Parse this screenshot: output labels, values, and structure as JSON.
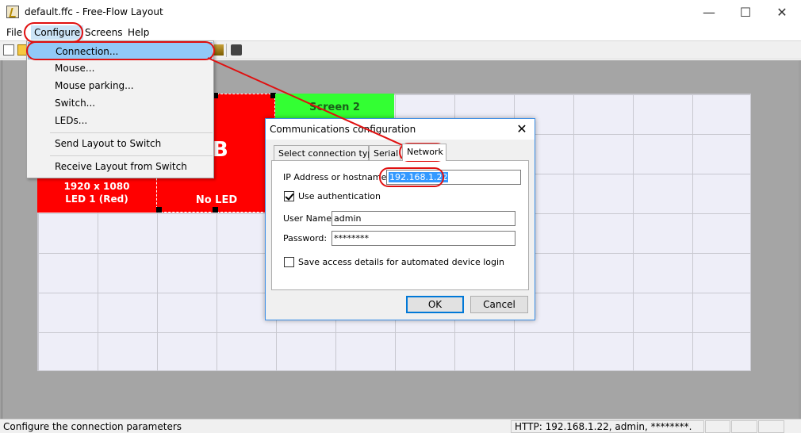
{
  "window": {
    "title": "default.ffc - Free-Flow Layout",
    "min_glyph": "—",
    "max_glyph": "☐",
    "close_glyph": "✕"
  },
  "menubar": {
    "file": "File",
    "configure": "Configure",
    "screens": "Screens",
    "help": "Help"
  },
  "configure_menu": {
    "items": [
      "Connection...",
      "Mouse...",
      "Mouse parking...",
      "Switch...",
      "LEDs...",
      "Send Layout to Switch",
      "Receive Layout from Switch"
    ],
    "highlighted": "Connection..."
  },
  "screens": {
    "a": {
      "resolution": "1920 x 1080",
      "led": "LED 1 (Red)",
      "color": "#ff0000"
    },
    "b": {
      "letter": "B",
      "led": "No LED",
      "color": "#ff0000"
    },
    "s2": {
      "name": "Screen 2",
      "color": "#33ff33"
    }
  },
  "dialog": {
    "title": "Communications configuration",
    "close_glyph": "✕",
    "tabs": [
      "Select connection type",
      "Serial",
      "Network"
    ],
    "active_tab": "Network",
    "ip_label": "IP Address or hostname:",
    "ip_value": "192.168.1.22",
    "use_auth_label": "Use authentication",
    "use_auth_checked": true,
    "username_label": "User Name:",
    "username_value": "admin",
    "password_label": "Password:",
    "password_value": "********",
    "save_access_label": "Save access details for automated device login",
    "save_access_checked": false,
    "ok": "OK",
    "cancel": "Cancel"
  },
  "statusbar": {
    "message": "Configure the connection parameters",
    "connection": "HTTP: 192.168.1.22, admin, ********."
  },
  "annotation_color": "#e01010"
}
